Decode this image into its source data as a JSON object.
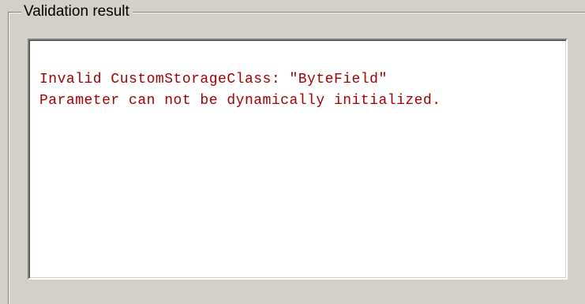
{
  "group": {
    "title": "Validation result"
  },
  "output": {
    "text_color": "#a00000",
    "lines": [
      "Invalid CustomStorageClass: \"ByteField\"",
      "Parameter can not be dynamically initialized."
    ]
  },
  "colors": {
    "background": "#d4d0c8",
    "output_background": "#ffffff"
  }
}
